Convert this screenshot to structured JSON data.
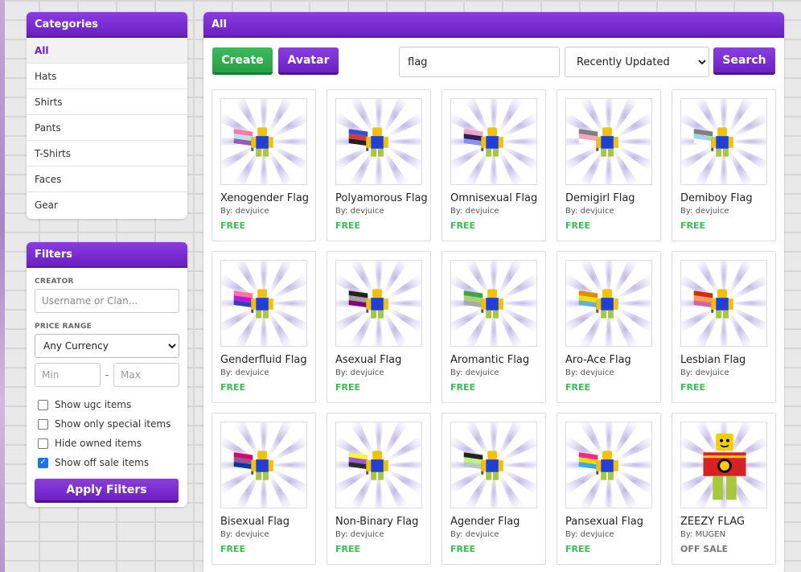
{
  "categories": {
    "title": "Categories",
    "items": [
      "All",
      "Hats",
      "Shirts",
      "Pants",
      "T-Shirts",
      "Faces",
      "Gear"
    ],
    "active": "All"
  },
  "filters": {
    "title": "Filters",
    "creator_label": "CREATOR",
    "creator_placeholder": "Username or Clan...",
    "price_label": "PRICE RANGE",
    "currency_selected": "Any Currency",
    "min_placeholder": "Min",
    "max_placeholder": "Max",
    "range_separator": "-",
    "checkboxes": [
      {
        "label": "Show ugc items",
        "checked": false
      },
      {
        "label": "Show only special items",
        "checked": false
      },
      {
        "label": "Hide owned items",
        "checked": false
      },
      {
        "label": "Show off sale items",
        "checked": true
      }
    ],
    "apply_label": "Apply Filters"
  },
  "main": {
    "title": "All",
    "create_label": "Create",
    "avatar_label": "Avatar",
    "search_value": "flag",
    "sort_selected": "Recently Updated",
    "search_label": "Search"
  },
  "items": [
    {
      "name": "Xenogender Flag",
      "creator": "By: devjuice",
      "price": "FREE",
      "flag_colors": [
        "#ff7aa8",
        "#b8e0f0",
        "#9b59b6"
      ]
    },
    {
      "name": "Polyamorous Flag",
      "creator": "By: devjuice",
      "price": "FREE",
      "flag_colors": [
        "#3a4ec9",
        "#d63a3a",
        "#222222"
      ]
    },
    {
      "name": "Omnisexual Flag",
      "creator": "By: devjuice",
      "price": "FREE",
      "flag_colors": [
        "#f5a0c8",
        "#2a1e5c",
        "#8a90f0"
      ]
    },
    {
      "name": "Demigirl Flag",
      "creator": "By: devjuice",
      "price": "FREE",
      "flag_colors": [
        "#7f7f7f",
        "#f5a6c0",
        "#ffffff"
      ]
    },
    {
      "name": "Demiboy Flag",
      "creator": "By: devjuice",
      "price": "FREE",
      "flag_colors": [
        "#7f7f7f",
        "#9fd4ea",
        "#ffffff"
      ]
    },
    {
      "name": "Genderfluid Flag",
      "creator": "By: devjuice",
      "price": "FREE",
      "flag_colors": [
        "#ff75a2",
        "#be18d6",
        "#333ebd"
      ]
    },
    {
      "name": "Asexual Flag",
      "creator": "By: devjuice",
      "price": "FREE",
      "flag_colors": [
        "#222222",
        "#a3a3a3",
        "#800080"
      ]
    },
    {
      "name": "Aromantic Flag",
      "creator": "By: devjuice",
      "price": "FREE",
      "flag_colors": [
        "#3da542",
        "#a7d379",
        "#a9a9a9"
      ]
    },
    {
      "name": "Aro-Ace Flag",
      "creator": "By: devjuice",
      "price": "FREE",
      "flag_colors": [
        "#e28c00",
        "#ece100",
        "#62aedc"
      ]
    },
    {
      "name": "Lesbian Flag",
      "creator": "By: devjuice",
      "price": "FREE",
      "flag_colors": [
        "#d52d00",
        "#ff9a56",
        "#d362a4"
      ]
    },
    {
      "name": "Bisexual Flag",
      "creator": "By: devjuice",
      "price": "FREE",
      "flag_colors": [
        "#d60270",
        "#9b4f96",
        "#0038a8"
      ]
    },
    {
      "name": "Non-Binary Flag",
      "creator": "By: devjuice",
      "price": "FREE",
      "flag_colors": [
        "#fcf434",
        "#9c59d1",
        "#2c2c2c"
      ]
    },
    {
      "name": "Agender Flag",
      "creator": "By: devjuice",
      "price": "FREE",
      "flag_colors": [
        "#222222",
        "#b9f484",
        "#bcc4c7"
      ]
    },
    {
      "name": "Pansexual Flag",
      "creator": "By: devjuice",
      "price": "FREE",
      "flag_colors": [
        "#ff218c",
        "#ffd800",
        "#21b1ff"
      ]
    },
    {
      "name": "ZEEZY FLAG",
      "creator": "By: MUGEN",
      "price": "OFF SALE",
      "flag_colors": [
        "#d62222",
        "#ffcc00",
        "#000000"
      ],
      "type": "shirt"
    }
  ]
}
